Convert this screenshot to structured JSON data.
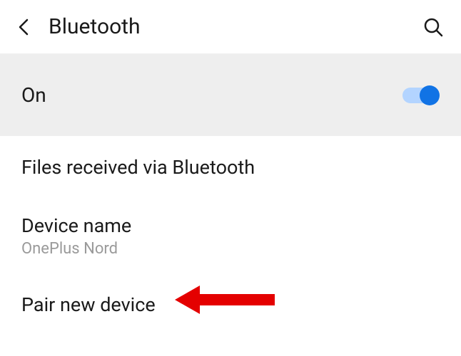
{
  "header": {
    "title": "Bluetooth"
  },
  "toggle": {
    "label": "On",
    "state": "on"
  },
  "rows": {
    "files": {
      "label": "Files received via Bluetooth"
    },
    "device_name": {
      "label": "Device name",
      "value": "OnePlus Nord"
    },
    "pair": {
      "label": "Pair new device"
    }
  }
}
